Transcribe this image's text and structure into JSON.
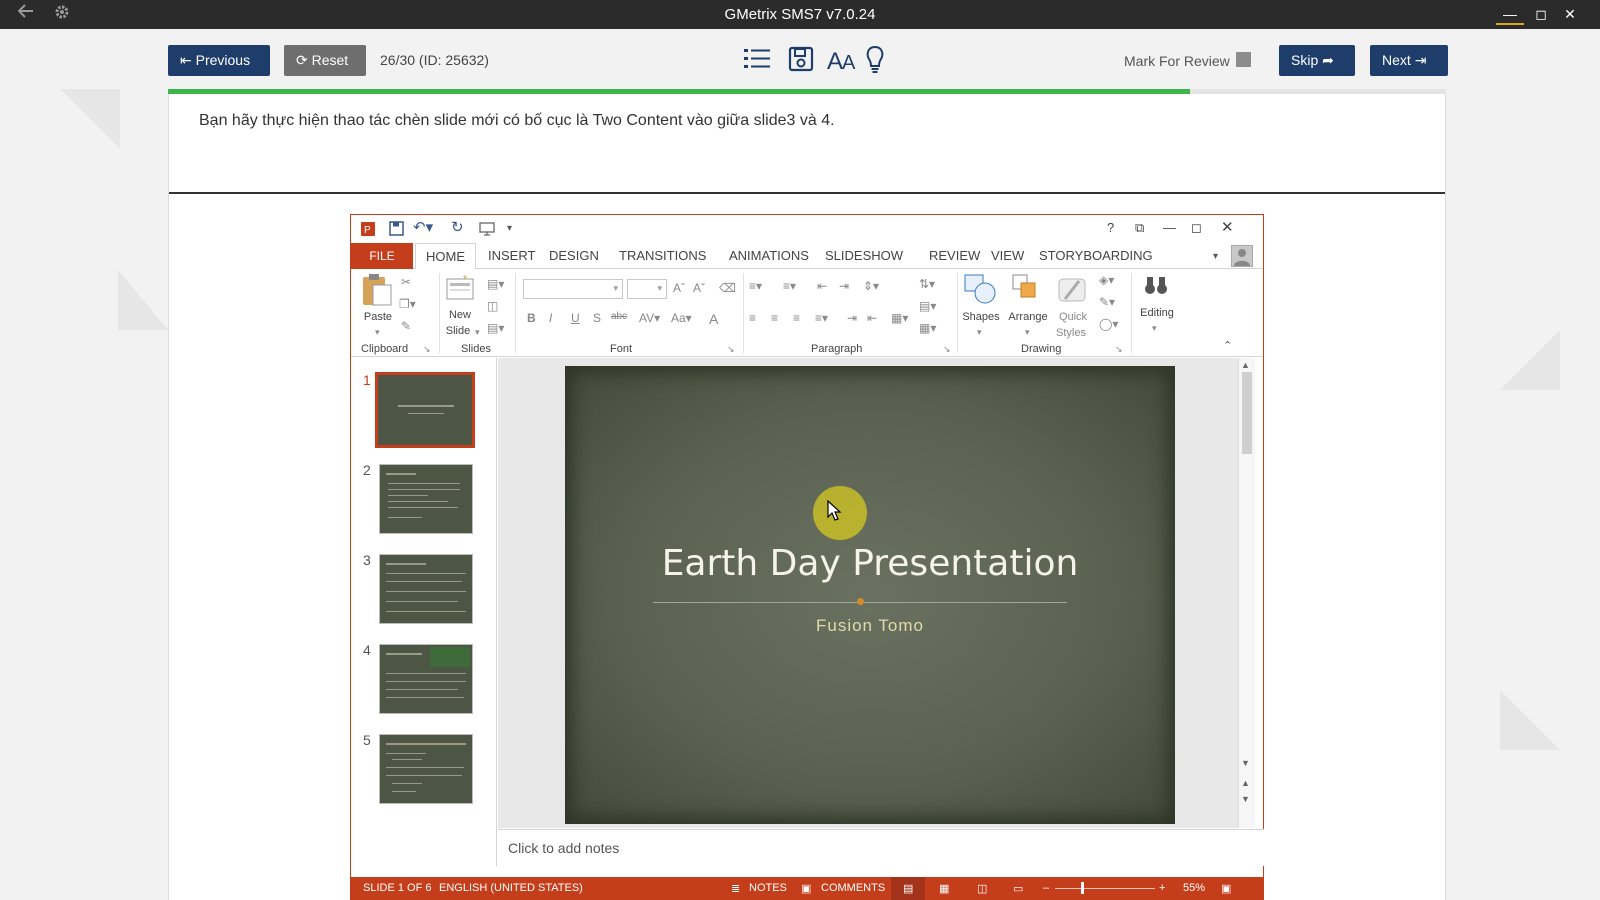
{
  "app": {
    "title": "GMetrix SMS7 v7.0.24"
  },
  "toolbar": {
    "previous_label": "Previous",
    "reset_label": "Reset",
    "question_counter": "26/30 (ID: 25632)",
    "mark_for_review_label": "Mark For Review",
    "skip_label": "Skip",
    "next_label": "Next",
    "icons": [
      "list-icon",
      "save-icon",
      "font-size-icon",
      "hint-bulb-icon"
    ]
  },
  "progress": {
    "fraction": 0.8
  },
  "question": {
    "text": "Bạn hãy thực hiện thao tác chèn slide mới có bố cục là Two Content vào giữa slide3 và 4."
  },
  "powerpoint": {
    "window_buttons": [
      "?",
      "restore",
      "minimize",
      "maximize",
      "close"
    ],
    "tabs": [
      "FILE",
      "HOME",
      "INSERT",
      "DESIGN",
      "TRANSITIONS",
      "ANIMATIONS",
      "SLIDESHOW",
      "REVIEW",
      "VIEW",
      "STORYBOARDING"
    ],
    "active_tab": "HOME",
    "ribbon": {
      "paste": "Paste",
      "new_slide_1": "New",
      "new_slide_2": "Slide",
      "shapes": "Shapes",
      "arrange": "Arrange",
      "quick_1": "Quick",
      "quick_2": "Styles",
      "editing": "Editing",
      "bold": "B",
      "italic": "I",
      "underline": "U",
      "strike": "S",
      "abc": "abc",
      "font_color": "A",
      "groups": {
        "clipboard": "Clipboard",
        "slides": "Slides",
        "font": "Font",
        "paragraph": "Paragraph",
        "drawing": "Drawing"
      }
    },
    "slides": [
      {
        "number": "1",
        "selected": true
      },
      {
        "number": "2",
        "selected": false
      },
      {
        "number": "3",
        "selected": false
      },
      {
        "number": "4",
        "selected": false
      },
      {
        "number": "5",
        "selected": false
      }
    ],
    "current_slide": {
      "title": "Earth Day Presentation",
      "subtitle": "Fusion Tomo"
    },
    "notes_placeholder": "Click to add notes",
    "status": {
      "slide_info": "SLIDE 1 OF 6",
      "language": "ENGLISH (UNITED STATES)",
      "notes": "NOTES",
      "comments": "COMMENTS",
      "zoom": "55%"
    },
    "accent_color": "#c43e1c"
  },
  "colors": {
    "navy_button": "#1f3d6b",
    "reset_button": "#6e6e6e",
    "progress": "#3db54a",
    "title_bar": "#2b2b2b"
  }
}
